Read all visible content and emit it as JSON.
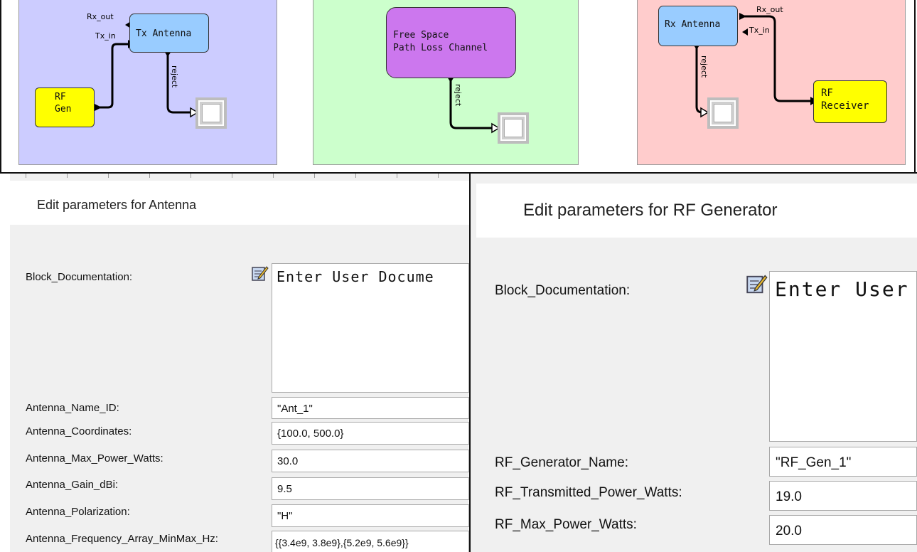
{
  "diagram": {
    "tx_region": {
      "rf_gen_label": "RF\nGen",
      "tx_antenna_label": "Tx Antenna",
      "port_rx_out": "Rx_out",
      "port_tx_in": "Tx_in",
      "wire_label": "reject",
      "color": "#ccccff"
    },
    "channel_region": {
      "channel_label": "Free Space\nPath Loss Channel",
      "wire_label": "reject",
      "color": "#ccffcc"
    },
    "rx_region": {
      "rx_antenna_label": "Rx Antenna",
      "receiver_label": "RF\nReceiver",
      "port_rx_out": "Rx_out",
      "port_tx_in": "Tx_in",
      "wire_label": "reject",
      "color": "#ffcccc"
    }
  },
  "antenna_panel": {
    "title": "Edit parameters for Antenna",
    "doc_label": "Block_Documentation:",
    "doc_value": "Enter User Docume",
    "params": [
      {
        "label": "Antenna_Name_ID:",
        "value": "\"Ant_1\""
      },
      {
        "label": "Antenna_Coordinates:",
        "value": "{100.0, 500.0}"
      },
      {
        "label": "Antenna_Max_Power_Watts:",
        "value": "30.0"
      },
      {
        "label": "Antenna_Gain_dBi:",
        "value": "9.5"
      },
      {
        "label": "Antenna_Polarization:",
        "value": "\"H\""
      },
      {
        "label": "Antenna_Frequency_Array_MinMax_Hz:",
        "value": "{{3.4e9, 3.8e9},{5.2e9, 5.6e9}}"
      }
    ]
  },
  "rf_panel": {
    "title": "Edit parameters for RF Generator",
    "doc_label": "Block_Documentation:",
    "doc_value": "Enter User",
    "params": [
      {
        "label": "RF_Generator_Name:",
        "value": "\"RF_Gen_1\""
      },
      {
        "label": "RF_Transmitted_Power_Watts:",
        "value": "19.0"
      },
      {
        "label": "RF_Max_Power_Watts:",
        "value": "20.0"
      }
    ]
  }
}
